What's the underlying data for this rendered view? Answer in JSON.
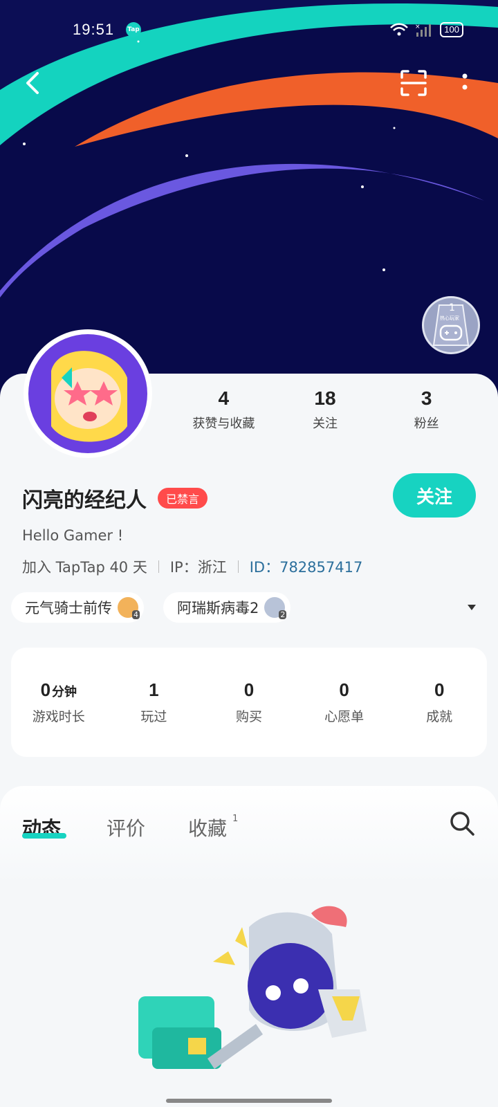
{
  "status_bar": {
    "time": "19:51",
    "app_icon": "Tap",
    "battery": "100"
  },
  "icons": {
    "back": "chevron-left-icon",
    "scan": "scan-icon",
    "more": "more-vertical-icon",
    "search": "search-icon"
  },
  "badge": {
    "count": "1",
    "text": "热心玩家"
  },
  "profile": {
    "stats": [
      {
        "value": "4",
        "label": "获赞与收藏"
      },
      {
        "value": "18",
        "label": "关注"
      },
      {
        "value": "3",
        "label": "粉丝"
      }
    ],
    "name": "闪亮的经纪人",
    "status_badge": "已禁言",
    "follow_label": "关注",
    "bio": "Hello Gamer !",
    "joined": "加入 TapTap 40 天",
    "ip": "IP：浙江",
    "id_label": "ID：782857417"
  },
  "games": [
    {
      "name": "元气骑士前传",
      "level": "4"
    },
    {
      "name": "阿瑞斯病毒2",
      "level": "2"
    }
  ],
  "game_stats": [
    {
      "value": "0",
      "unit": "分钟",
      "label": "游戏时长"
    },
    {
      "value": "1",
      "unit": "",
      "label": "玩过"
    },
    {
      "value": "0",
      "unit": "",
      "label": "购买"
    },
    {
      "value": "0",
      "unit": "",
      "label": "心愿单"
    },
    {
      "value": "0",
      "unit": "",
      "label": "成就"
    }
  ],
  "tabs": [
    {
      "label": "动态",
      "count": ""
    },
    {
      "label": "评价",
      "count": ""
    },
    {
      "label": "收藏",
      "count": "1"
    }
  ],
  "colors": {
    "accent": "#17d3c1",
    "hero_bg": "#080a4a",
    "muted_badge": "#ff4b4b",
    "id_text": "#2c6f9c"
  }
}
